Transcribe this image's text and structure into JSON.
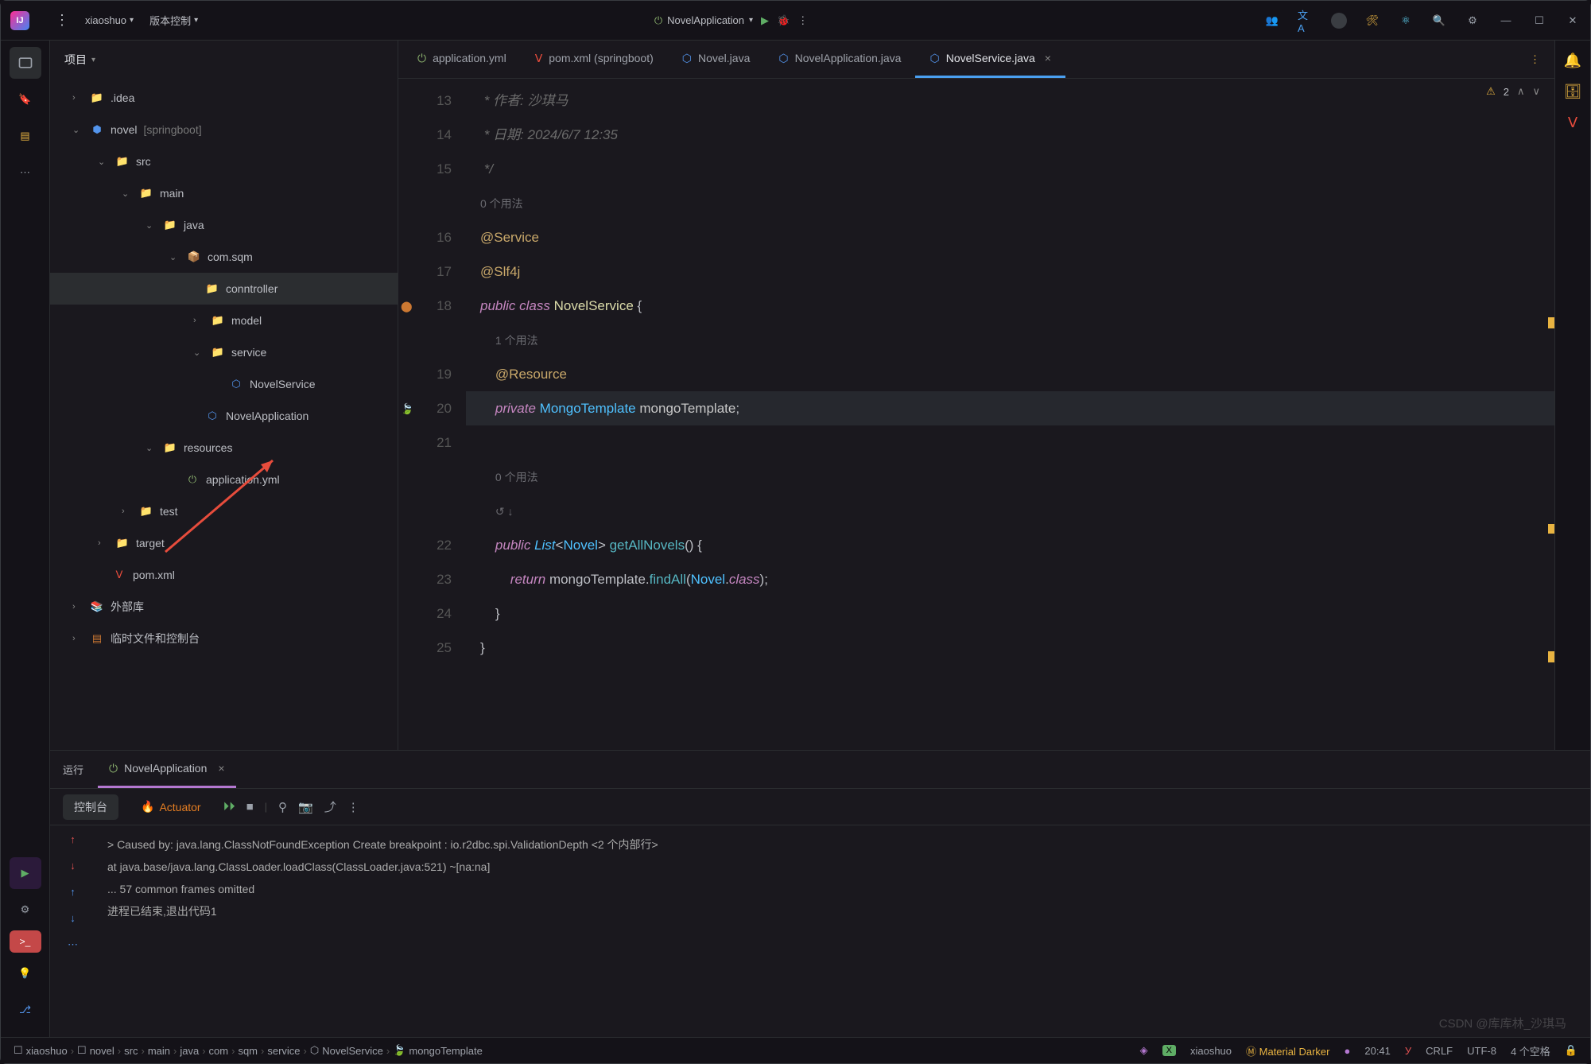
{
  "titlebar": {
    "project": "xiaoshuo",
    "vcs": "版本控制",
    "run_config": "NovelApplication"
  },
  "sidebar": {
    "title": "项目",
    "tree": {
      "idea": ".idea",
      "novel_label": "novel",
      "novel_hint": "[springboot]",
      "src": "src",
      "main": "main",
      "java": "java",
      "pkg": "com.sqm",
      "controller": "conntroller",
      "model": "model",
      "service": "service",
      "novel_service": "NovelService",
      "novel_app": "NovelApplication",
      "resources": "resources",
      "app_yml": "application.yml",
      "test": "test",
      "target": "target",
      "pom": "pom.xml",
      "ext_libs": "外部库",
      "scratch": "临时文件和控制台"
    }
  },
  "tabs": [
    {
      "label": "application.yml",
      "icon": "power",
      "active": false
    },
    {
      "label": "pom.xml (springboot)",
      "icon": "maven",
      "active": false
    },
    {
      "label": "Novel.java",
      "icon": "java",
      "active": false
    },
    {
      "label": "NovelApplication.java",
      "icon": "java",
      "active": false
    },
    {
      "label": "NovelService.java",
      "icon": "java",
      "active": true,
      "closable": true
    }
  ],
  "warnings": {
    "count": "2"
  },
  "code": {
    "lines": [
      {
        "n": "13",
        "html": "<span class='comment'> * 作者: 沙琪马</span>"
      },
      {
        "n": "14",
        "html": "<span class='comment'> * 日期: 2024/6/7 12:35</span>"
      },
      {
        "n": "15",
        "html": "<span class='comment'> */</span>"
      },
      {
        "n": "",
        "html": "<span class='hint'>0 个用法</span>"
      },
      {
        "n": "16",
        "html": "<span class='anno'>@Service</span>"
      },
      {
        "n": "17",
        "html": "<span class='anno'>@Slf4j</span>"
      },
      {
        "n": "18",
        "icon": "impl",
        "html": "<span class='kw'>public</span> <span class='kw'>class</span> <span style='color:#dcdcaa'>NovelService</span> {"
      },
      {
        "n": "",
        "html": "    <span class='hint'>1 个用法</span>"
      },
      {
        "n": "19",
        "html": "    <span class='anno'>@Resource</span>"
      },
      {
        "n": "20",
        "icon": "bean",
        "hl": true,
        "html": "    <span class='kw'>private</span> <span class='type'>MongoTemplate</span> <span style='color:#c8c8c8'>mongoTemplate</span>;"
      },
      {
        "n": "21",
        "html": ""
      },
      {
        "n": "",
        "html": "    <span class='hint'>0 个用法</span>"
      },
      {
        "n": "",
        "html": "    <span class='hint'>↺ ↓</span>"
      },
      {
        "n": "22",
        "html": "    <span class='kw'>public</span> <span class='type' style='font-style:italic'>List</span>&lt;<span class='type'>Novel</span>&gt; <span class='method'>getAllNovels</span>() {"
      },
      {
        "n": "23",
        "html": "        <span class='kw'>return</span> mongoTemplate.<span class='method'>findAll</span>(<span class='type'>Novel</span>.<span class='kw'>class</span>);"
      },
      {
        "n": "24",
        "html": "    }"
      },
      {
        "n": "25",
        "html": "}"
      }
    ]
  },
  "run_panel": {
    "title": "运行",
    "tab": "NovelApplication",
    "console_tab": "控制台",
    "actuator": "Actuator",
    "console": [
      "> Caused by: java.lang.ClassNotFoundException  Create breakpoint         : io.r2dbc.spi.ValidationDepth <2 个内部行>",
      "    at java.base/java.lang.ClassLoader.loadClass(ClassLoader.java:521) ~[na:na]",
      "    ... 57 common frames omitted",
      "",
      "进程已结束,退出代码1"
    ]
  },
  "breadcrumbs": [
    "xiaoshuo",
    "novel",
    "src",
    "main",
    "java",
    "com",
    "sqm",
    "service",
    "NovelService",
    "mongoTemplate"
  ],
  "status": {
    "branch": "xiaoshuo",
    "theme": "Material Darker",
    "time": "20:41",
    "lf": "CRLF",
    "enc": "UTF-8",
    "indent": "4 个空格"
  },
  "watermark": "CSDN @库库林_沙琪马"
}
